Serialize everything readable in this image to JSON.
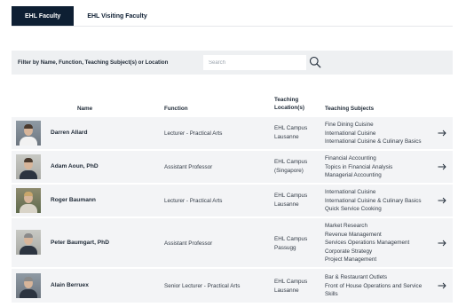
{
  "tabs": [
    {
      "label": "EHL Faculty",
      "active": true
    },
    {
      "label": "EHL Visiting Faculty",
      "active": false
    }
  ],
  "filter": {
    "label": "Filter by Name, Function, Teaching Subject(s) or Location",
    "search_placeholder": "Search"
  },
  "table": {
    "headers": {
      "name": "Name",
      "function": "Function",
      "location_line1": "Teaching",
      "location_line2": "Location(s)",
      "subjects": "Teaching Subjects"
    },
    "rows": [
      {
        "name": "Darren Allard",
        "function": "Lecturer - Practical Arts",
        "location": [
          "EHL Campus",
          "Lausanne"
        ],
        "subjects": [
          "Fine Dining Cuisine",
          "International Cuisine",
          "International Cuisine & Culinary Basics"
        ]
      },
      {
        "name": "Adam Aoun, PhD",
        "function": "Assistant Professor",
        "location": [
          "EHL Campus",
          "(Singapore)"
        ],
        "subjects": [
          "Financial Accounting",
          "Topics in Financial Analysis",
          "Managerial Accounting"
        ]
      },
      {
        "name": "Roger Baumann",
        "function": "Lecturer - Practical Arts",
        "location": [
          "EHL Campus",
          "Lausanne"
        ],
        "subjects": [
          "International Cuisine",
          "International Cuisine & Culinary Basics",
          "Quick Service Cooking"
        ]
      },
      {
        "name": "Peter Baumgart, PhD",
        "function": "Assistant Professor",
        "location": [
          "EHL Campus",
          "Passugg"
        ],
        "subjects": [
          "Market Research",
          "Revenue Management",
          "Services Operations Management",
          "Corporate Strategy",
          "Project Management"
        ]
      },
      {
        "name": "Alain Berruex",
        "function": "Senior Lecturer - Practical Arts",
        "location": [
          "EHL Campus",
          "Lausanne"
        ],
        "subjects": [
          "Bar & Restaurant Outlets",
          "Front of House Operations and Service",
          "Skills"
        ]
      }
    ]
  },
  "icons": {
    "search": "search-icon",
    "row_arrow": "arrow-right-icon"
  },
  "colors": {
    "tab_active_bg": "#0e1f33",
    "filter_bg": "#eef0f2",
    "row_bg": "#f3f4f6"
  }
}
